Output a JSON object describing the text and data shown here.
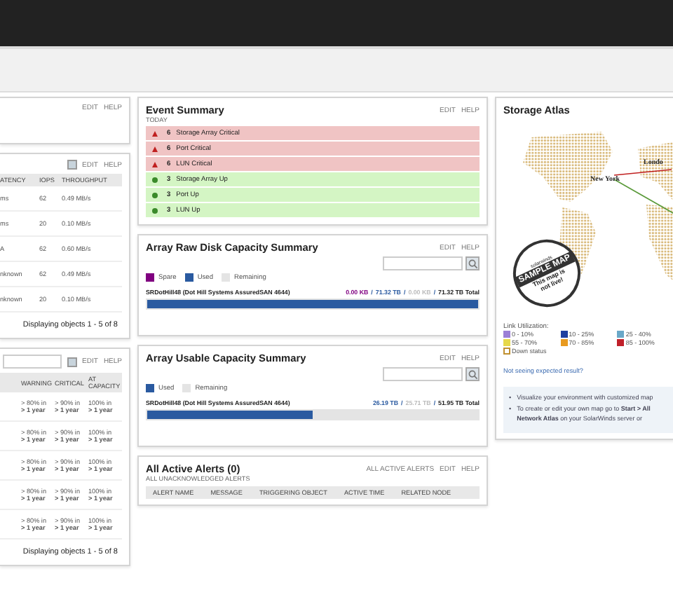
{
  "left_top_panel": {
    "buttons": [
      "EDIT",
      "HELP"
    ]
  },
  "performance_panel": {
    "buttons": [
      "EDIT",
      "HELP"
    ],
    "columns": [
      "ATENCY",
      "IOPS",
      "THROUGHPUT"
    ],
    "rows": [
      [
        "ms",
        "62",
        "0.49 MB/s"
      ],
      [
        "ms",
        "20",
        "0.10 MB/s"
      ],
      [
        "A",
        "62",
        "0.60 MB/s"
      ],
      [
        "nknown",
        "62",
        "0.49 MB/s"
      ],
      [
        "nknown",
        "20",
        "0.10 MB/s"
      ]
    ],
    "footer": "Displaying objects 1 - 5 of 8"
  },
  "threshold_panel": {
    "buttons": [
      "EDIT",
      "HELP"
    ],
    "columns": [
      "WARNING",
      "CRITICAL",
      "AT CAPACITY"
    ],
    "rows": [
      [
        [
          "> 80% in",
          "> 1 year"
        ],
        [
          "> 90% in",
          "> 1 year"
        ],
        [
          "100% in",
          "> 1 year"
        ]
      ],
      [
        [
          "> 80% in",
          "> 1 year"
        ],
        [
          "> 90% in",
          "> 1 year"
        ],
        [
          "100% in",
          "> 1 year"
        ]
      ],
      [
        [
          "> 80% in",
          "> 1 year"
        ],
        [
          "> 90% in",
          "> 1 year"
        ],
        [
          "100% in",
          "> 1 year"
        ]
      ],
      [
        [
          "> 80% in",
          "> 1 year"
        ],
        [
          "> 90% in",
          "> 1 year"
        ],
        [
          "100% in",
          "> 1 year"
        ]
      ],
      [
        [
          "> 80% in",
          "> 1 year"
        ],
        [
          "> 90% in",
          "> 1 year"
        ],
        [
          "100% in",
          "> 1 year"
        ]
      ]
    ],
    "footer": "Displaying objects 1 - 5 of 8"
  },
  "event_summary": {
    "title": "Event Summary",
    "subtitle": "TODAY",
    "buttons": [
      "EDIT",
      "HELP"
    ],
    "events": [
      {
        "kind": "critical",
        "count": "6",
        "label": "Storage Array Critical"
      },
      {
        "kind": "critical",
        "count": "6",
        "label": "Port Critical"
      },
      {
        "kind": "critical",
        "count": "6",
        "label": "LUN Critical"
      },
      {
        "kind": "up",
        "count": "3",
        "label": "Storage Array Up"
      },
      {
        "kind": "up",
        "count": "3",
        "label": "Port Up"
      },
      {
        "kind": "up",
        "count": "3",
        "label": "LUN Up"
      }
    ]
  },
  "raw_capacity": {
    "title": "Array Raw Disk Capacity Summary",
    "buttons": [
      "EDIT",
      "HELP"
    ],
    "legend": [
      {
        "label": "Spare",
        "color": "#800080"
      },
      {
        "label": "Used",
        "color": "#2a5aa0"
      },
      {
        "label": "Remaining",
        "color": "#e4e4e4"
      }
    ],
    "rows": [
      {
        "name": "SRDotHill48 (Dot Hill Systems AssuredSAN 4644)",
        "values": [
          {
            "text": "0.00 KB",
            "color": "#800080",
            "separator": "/"
          },
          {
            "text": "71.32 TB",
            "color": "#2a5aa0",
            "separator": "/"
          },
          {
            "text": "0.00 KB",
            "color": "#bbbbbb",
            "separator": "/"
          }
        ],
        "total": "71.32 TB Total",
        "level": 1.0
      }
    ]
  },
  "usable_capacity": {
    "title": "Array Usable Capacity Summary",
    "buttons": [
      "EDIT",
      "HELP"
    ],
    "legend": [
      {
        "label": "Used",
        "color": "#2a5aa0"
      },
      {
        "label": "Remaining",
        "color": "#e4e4e4"
      }
    ],
    "rows": [
      {
        "name": "SRDotHill48 (Dot Hill Systems AssuredSAN 4644)",
        "values": [
          {
            "text": "26.19 TB",
            "color": "#2a5aa0",
            "separator": "/"
          },
          {
            "text": "25.71 TB",
            "color": "#bbbbbb",
            "separator": "/"
          }
        ],
        "total": "51.95 TB Total",
        "level": 0.5
      }
    ]
  },
  "active_alerts": {
    "title": "All Active Alerts (0)",
    "subtitle": "ALL UNACKNOWLEDGED ALERTS",
    "buttons": [
      "ALL ACTIVE ALERTS",
      "EDIT",
      "HELP"
    ],
    "columns": [
      "ALERT NAME",
      "MESSAGE",
      "TRIGGERING OBJECT",
      "ACTIVE TIME",
      "RELATED NODE"
    ]
  },
  "storage_atlas": {
    "title": "Storage Atlas",
    "cities": [
      "New York",
      "Londo"
    ],
    "stamp": {
      "brand": "solarwinds",
      "title": "SAMPLE MAP",
      "note": "This map is not live!"
    },
    "legend_title": "Link Utilization:",
    "legend": [
      {
        "label": "0 - 10%",
        "color": "#9b7fd6"
      },
      {
        "label": "10 - 25%",
        "color": "#1f3fa0"
      },
      {
        "label": "25 - 40%",
        "color": "#6aa8c8"
      },
      {
        "label": "55 - 70%",
        "color": "#e6d84a"
      },
      {
        "label": "70 - 85%",
        "color": "#e89a20"
      },
      {
        "label": "85 - 100%",
        "color": "#c0202a"
      }
    ],
    "down_status": "Down status",
    "link": "Not seeing expected result?",
    "tips": [
      {
        "bullet": "•",
        "text": "Visualize your environment with customized map"
      },
      {
        "bullet": "•",
        "text": "To create or edit your own map go to **Start > All** **Network Atlas** on your SolarWinds server or"
      }
    ]
  }
}
